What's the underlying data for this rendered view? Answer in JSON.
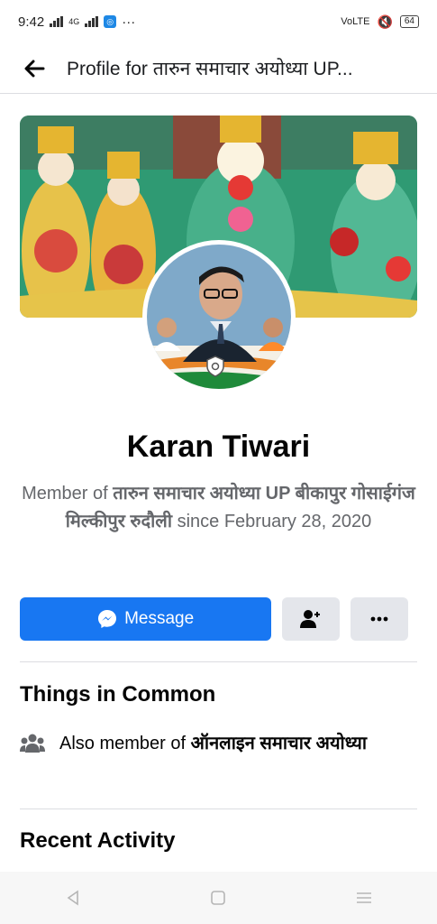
{
  "status_bar": {
    "time": "9:42",
    "network_label": "4G",
    "volte_label": "VoLTE",
    "battery": "64",
    "more": "···"
  },
  "header": {
    "back_icon": "arrow-left-icon",
    "title": "Profile for तारुन समाचार अयोध्या UP..."
  },
  "profile": {
    "name": "Karan Tiwari",
    "member_prefix": "Member of ",
    "group_name": "तारुन समाचार अयोध्या UP बीकापुर गोसाईगंज मिल्कीपुर रुदौली",
    "member_suffix": " since February 28, 2020"
  },
  "actions": {
    "message_label": "Message",
    "add_friend_icon": "add-friend-icon",
    "more_icon": "more-dots-icon"
  },
  "things_in_common": {
    "title": "Things in Common",
    "prefix": "Also member of ",
    "group": "ऑनलाइन समाचार अयोध्या"
  },
  "recent_activity": {
    "title": "Recent Activity"
  },
  "colors": {
    "primary": "#1877f2",
    "secondary_bg": "#e4e6eb",
    "muted_text": "#65676b"
  }
}
